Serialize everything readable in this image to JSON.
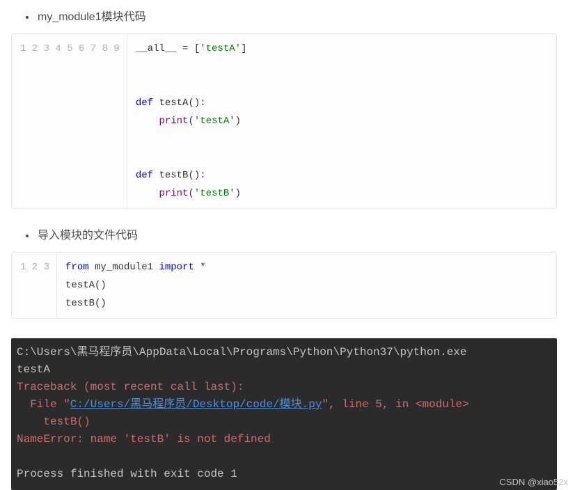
{
  "heading1": "my_module1模块代码",
  "heading2": "导入模块的文件代码",
  "code1": {
    "gutter": [
      "1",
      "2",
      "3",
      "4",
      "5",
      "6",
      "7",
      "8",
      "9"
    ],
    "tokens": [
      [
        {
          "t": "__all__",
          "c": "ident"
        },
        {
          "t": " = [",
          "c": "op"
        },
        {
          "t": "'testA'",
          "c": "str"
        },
        {
          "t": "]",
          "c": "op"
        }
      ],
      [],
      [],
      [
        {
          "t": "def",
          "c": "kw"
        },
        {
          "t": " ",
          "c": "op"
        },
        {
          "t": "testA",
          "c": "ident"
        },
        {
          "t": "():",
          "c": "op"
        }
      ],
      [
        {
          "t": "    ",
          "c": "op"
        },
        {
          "t": "print",
          "c": "builtin"
        },
        {
          "t": "(",
          "c": "op"
        },
        {
          "t": "'testA'",
          "c": "str"
        },
        {
          "t": ")",
          "c": "op"
        }
      ],
      [],
      [],
      [
        {
          "t": "def",
          "c": "kw"
        },
        {
          "t": " ",
          "c": "op"
        },
        {
          "t": "testB",
          "c": "ident"
        },
        {
          "t": "():",
          "c": "op"
        }
      ],
      [
        {
          "t": "    ",
          "c": "op"
        },
        {
          "t": "print",
          "c": "builtin"
        },
        {
          "t": "(",
          "c": "op"
        },
        {
          "t": "'testB'",
          "c": "str"
        },
        {
          "t": ")",
          "c": "op"
        }
      ]
    ]
  },
  "code2": {
    "gutter": [
      "1",
      "2",
      "3"
    ],
    "tokens": [
      [
        {
          "t": "from",
          "c": "kw"
        },
        {
          "t": " my_module1 ",
          "c": "ident"
        },
        {
          "t": "import",
          "c": "kw"
        },
        {
          "t": " *",
          "c": "op"
        }
      ],
      [
        {
          "t": "testA()",
          "c": "ident"
        }
      ],
      [
        {
          "t": "testB()",
          "c": "ident"
        }
      ]
    ]
  },
  "terminal": {
    "line1": "C:\\Users\\黑马程序员\\AppData\\Local\\Programs\\Python\\Python37\\python.exe",
    "line2": "testA",
    "trace1": "Traceback (most recent call last):",
    "file_prefix": "  File \"",
    "file_link": "C:/Users/黑马程序员/Desktop/code/模块.py",
    "file_suffix": "\", line 5, in <module>",
    "call": "    testB()",
    "err": "NameError: name 'testB' is not defined",
    "blank": "",
    "exit": "Process finished with exit code 1"
  },
  "watermark": "CSDN @xiao52x"
}
